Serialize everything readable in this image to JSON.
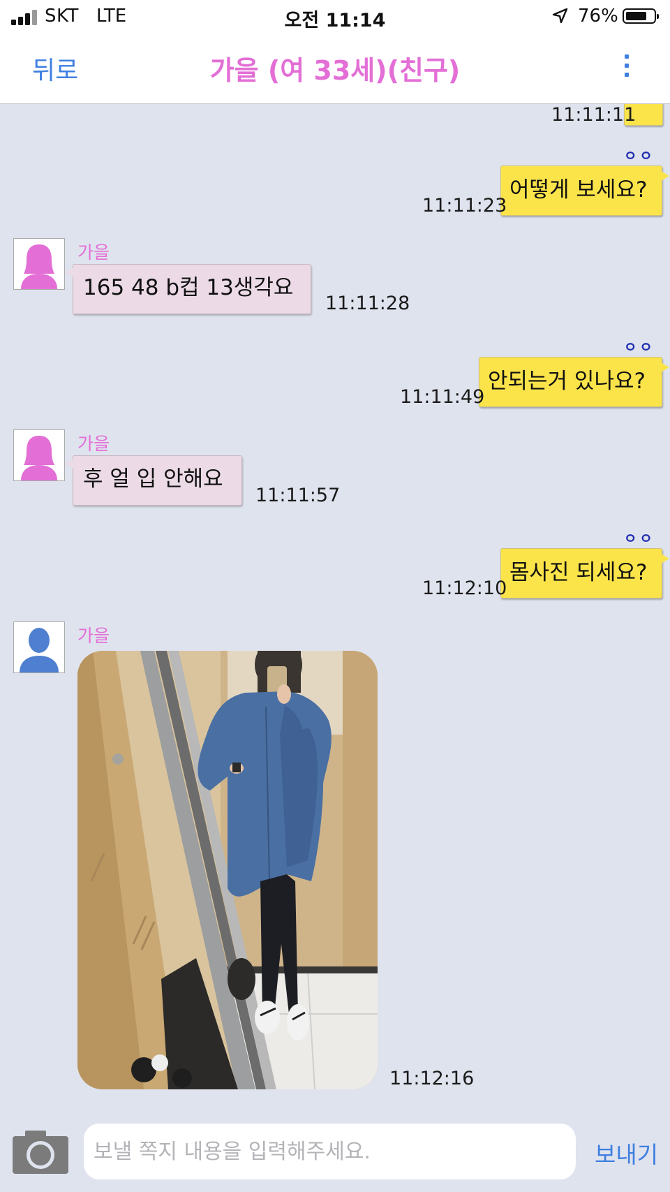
{
  "status_bar": {
    "carrier": "SKT",
    "network": "LTE",
    "time": "오전 11:14",
    "battery_percent": "76%",
    "battery_level": 0.76
  },
  "nav": {
    "back_label": "뒤로",
    "title": "가을 (여 33세)(친구)"
  },
  "colors": {
    "accent_blue": "#3f7fe0",
    "title_pink": "#e36fd6",
    "outgoing_bubble": "#fbe44a",
    "incoming_bubble": "#ecdbe7",
    "chat_background": "#dfe3ee"
  },
  "messages": [
    {
      "direction": "out",
      "text": "",
      "time": "11:11:11"
    },
    {
      "direction": "out",
      "text": "어떻게 보세요?",
      "time": "11:11:23",
      "read_mark": "ㅇㅇ"
    },
    {
      "direction": "in",
      "sender": "가을",
      "text": "165 48 b컵 13생각요",
      "time": "11:11:28",
      "avatar": "female-avatar-icon"
    },
    {
      "direction": "out",
      "text": "안되는거 있나요?",
      "time": "11:11:49",
      "read_mark": "ㅇㅇ"
    },
    {
      "direction": "in",
      "sender": "가을",
      "text": "후 얼 입 안해요",
      "time": "11:11:57",
      "avatar": "female-avatar-icon"
    },
    {
      "direction": "out",
      "text": "몸사진 되세요?",
      "time": "11:12:10",
      "read_mark": "ㅇㅇ"
    },
    {
      "direction": "in",
      "sender": "가을",
      "type": "photo",
      "time": "11:12:16",
      "avatar": "male-avatar-icon"
    }
  ],
  "composer": {
    "camera_icon": "camera-icon",
    "placeholder": "보낼 쪽지 내용을 입력해주세요.",
    "value": "",
    "send_label": "보내기"
  }
}
